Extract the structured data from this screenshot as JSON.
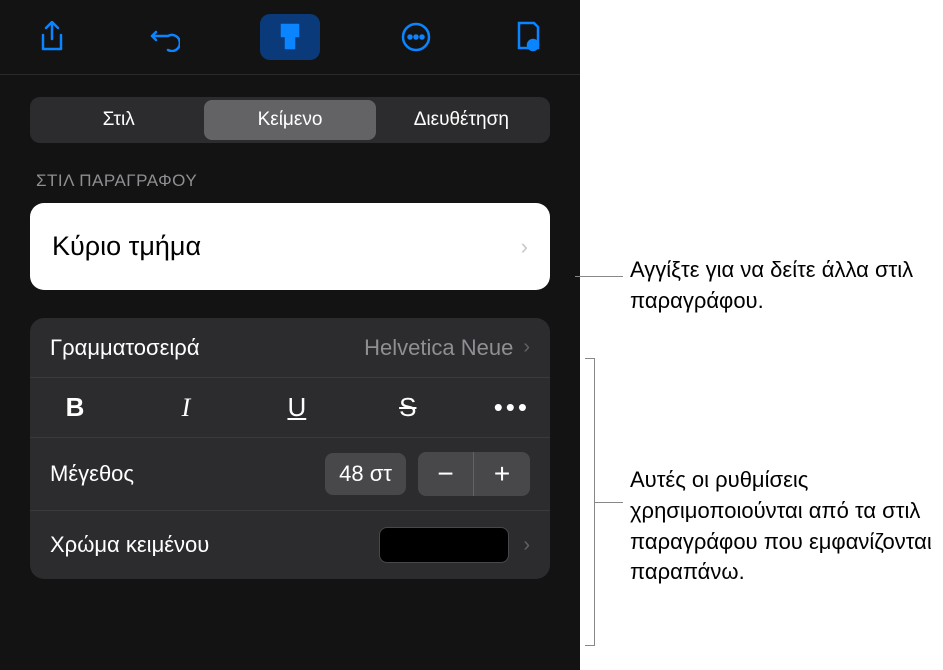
{
  "tabs": {
    "style": "Στιλ",
    "text": "Κείμενο",
    "arrange": "Διευθέτηση"
  },
  "paragraph_style": {
    "section_label": "ΣΤΙΛ ΠΑΡΑΓΡΑΦΟΥ",
    "current": "Κύριο τμήμα"
  },
  "font": {
    "label": "Γραμματοσειρά",
    "value": "Helvetica Neue"
  },
  "format": {
    "bold": "B",
    "italic": "I",
    "underline": "U",
    "strike": "S",
    "more": "•••"
  },
  "size": {
    "label": "Μέγεθος",
    "value": "48 στ"
  },
  "color": {
    "label": "Χρώμα κειμένου",
    "value": "#000000"
  },
  "callouts": {
    "c1": "Αγγίξτε για να δείτε άλλα στιλ παραγράφου.",
    "c2": "Αυτές οι ρυθμίσεις χρησιμοποιούνται από τα στιλ παραγράφου που εμφανίζονται παραπάνω."
  }
}
